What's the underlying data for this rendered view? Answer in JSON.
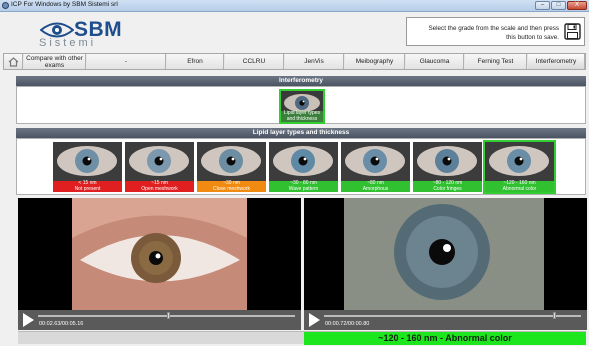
{
  "window": {
    "title": "ICP For Windows by SBM Sistemi srl",
    "min_label": "–",
    "max_label": "□",
    "close_label": "X"
  },
  "logo": {
    "brand": "SBM",
    "sub": "Sistemi"
  },
  "save_panel": {
    "message": "Select the grade from the scale and then press this button to save."
  },
  "tabs": [
    {
      "label": "Compare with other exams"
    },
    {
      "label": "-"
    },
    {
      "label": "Efron"
    },
    {
      "label": "CCLRU"
    },
    {
      "label": "JenVis"
    },
    {
      "label": "Meibography"
    },
    {
      "label": "Glaucoma"
    },
    {
      "label": "Ferning Test"
    },
    {
      "label": "Interferometry",
      "active": true
    }
  ],
  "interferometry_section": {
    "title": "Interferometry",
    "thumb": {
      "caption": "Lipid layer types and thickness"
    }
  },
  "lipid_section": {
    "title": "Lipid layer types and thickness",
    "grades": [
      {
        "value": "< 15 nm",
        "desc": "Not present",
        "color": "#e02020"
      },
      {
        "value": "~15 nm",
        "desc": "Open meshwork",
        "color": "#e02020"
      },
      {
        "value": "~30 nm",
        "desc": "Close meshwork",
        "color": "#f08a10"
      },
      {
        "value": "~30 - 80 nm",
        "desc": "Wave pattern",
        "color": "#30c030"
      },
      {
        "value": "~80 nm",
        "desc": "Amorphous",
        "color": "#30c030"
      },
      {
        "value": "~80 - 120 nm",
        "desc": "Color fringes",
        "color": "#30c030"
      },
      {
        "value": "~120 - 160 nm",
        "desc": "Abnormal color",
        "color": "#30c030",
        "selected": true
      }
    ]
  },
  "players": [
    {
      "time": "00:02.63/00:05.16",
      "progress": 0.51
    },
    {
      "time": "00:00.72/00:00.80",
      "progress": 0.9
    }
  ],
  "result": {
    "label": "~120 - 160 nm - Abnormal color"
  }
}
